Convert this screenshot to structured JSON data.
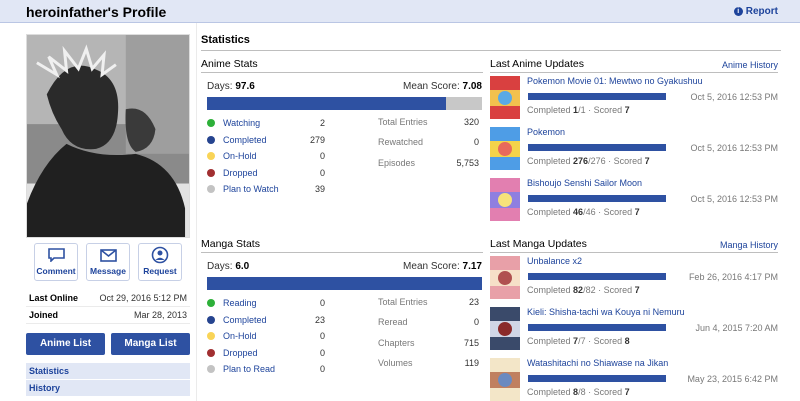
{
  "profile": {
    "title": "heroinfather's Profile",
    "report": "Report"
  },
  "sidebar": {
    "actions": [
      {
        "label": "Comment",
        "icon": "comment-icon"
      },
      {
        "label": "Message",
        "icon": "envelope-icon"
      },
      {
        "label": "Request",
        "icon": "friend-request-icon"
      }
    ],
    "info": [
      {
        "label": "Last Online",
        "value": "Oct 29, 2016 5:12 PM"
      },
      {
        "label": "Joined",
        "value": "Mar 28, 2013"
      }
    ],
    "anime_list_btn": "Anime List",
    "manga_list_btn": "Manga List",
    "links": [
      "Statistics",
      "History"
    ]
  },
  "stats": {
    "heading": "Statistics",
    "anime": {
      "title": "Anime Stats",
      "days_label": "Days:",
      "days": "97.6",
      "mean_label": "Mean Score:",
      "mean": "7.08",
      "fill_fraction": 0.87,
      "statuses": [
        {
          "name": "Watching",
          "count": "2",
          "color": "#2db039"
        },
        {
          "name": "Completed",
          "count": "279",
          "color": "#26448f"
        },
        {
          "name": "On-Hold",
          "count": "0",
          "color": "#f9d457"
        },
        {
          "name": "Dropped",
          "count": "0",
          "color": "#a12f31"
        },
        {
          "name": "Plan to Watch",
          "count": "39",
          "color": "#c3c3c3"
        }
      ],
      "totals": [
        {
          "label": "Total Entries",
          "value": "320"
        },
        {
          "label": "Rewatched",
          "value": "0"
        },
        {
          "label": "Episodes",
          "value": "5,753"
        }
      ]
    },
    "manga": {
      "title": "Manga Stats",
      "days_label": "Days:",
      "days": "6.0",
      "mean_label": "Mean Score:",
      "mean": "7.17",
      "fill_fraction": 1.0,
      "statuses": [
        {
          "name": "Reading",
          "count": "0",
          "color": "#2db039"
        },
        {
          "name": "Completed",
          "count": "23",
          "color": "#26448f"
        },
        {
          "name": "On-Hold",
          "count": "0",
          "color": "#f9d457"
        },
        {
          "name": "Dropped",
          "count": "0",
          "color": "#a12f31"
        },
        {
          "name": "Plan to Read",
          "count": "0",
          "color": "#c3c3c3"
        }
      ],
      "totals": [
        {
          "label": "Total Entries",
          "value": "23"
        },
        {
          "label": "Reread",
          "value": "0"
        },
        {
          "label": "Chapters",
          "value": "715"
        },
        {
          "label": "Volumes",
          "value": "119"
        }
      ]
    }
  },
  "anime_updates": {
    "title": "Last Anime Updates",
    "history": "Anime History",
    "items": [
      {
        "title": "Pokemon Movie 01: Mewtwo no Gyakushuu",
        "date": "Oct 5, 2016 12:53 PM",
        "status": "Completed",
        "progress": "1",
        "total": "/1",
        "scored_label": "· Scored",
        "score": "7"
      },
      {
        "title": "Pokemon",
        "date": "Oct 5, 2016 12:53 PM",
        "status": "Completed",
        "progress": "276",
        "total": "/276",
        "scored_label": "· Scored",
        "score": "7"
      },
      {
        "title": "Bishoujo Senshi Sailor Moon",
        "date": "Oct 5, 2016 12:53 PM",
        "status": "Completed",
        "progress": "46",
        "total": "/46",
        "scored_label": "· Scored",
        "score": "7"
      }
    ]
  },
  "manga_updates": {
    "title": "Last Manga Updates",
    "history": "Manga History",
    "items": [
      {
        "title": "Unbalance x2",
        "date": "Feb 26, 2016 4:17 PM",
        "status": "Completed",
        "progress": "82",
        "total": "/82",
        "scored_label": "· Scored",
        "score": "7"
      },
      {
        "title": "Kieli: Shisha-tachi wa Kouya ni Nemuru",
        "date": "Jun 4, 2015 7:20 AM",
        "status": "Completed",
        "progress": "7",
        "total": "/7",
        "scored_label": "· Scored",
        "score": "8"
      },
      {
        "title": "Watashitachi no Shiawase na Jikan",
        "date": "May 23, 2015 6:42 PM",
        "status": "Completed",
        "progress": "8",
        "total": "/8",
        "scored_label": "· Scored",
        "score": "7"
      }
    ]
  }
}
